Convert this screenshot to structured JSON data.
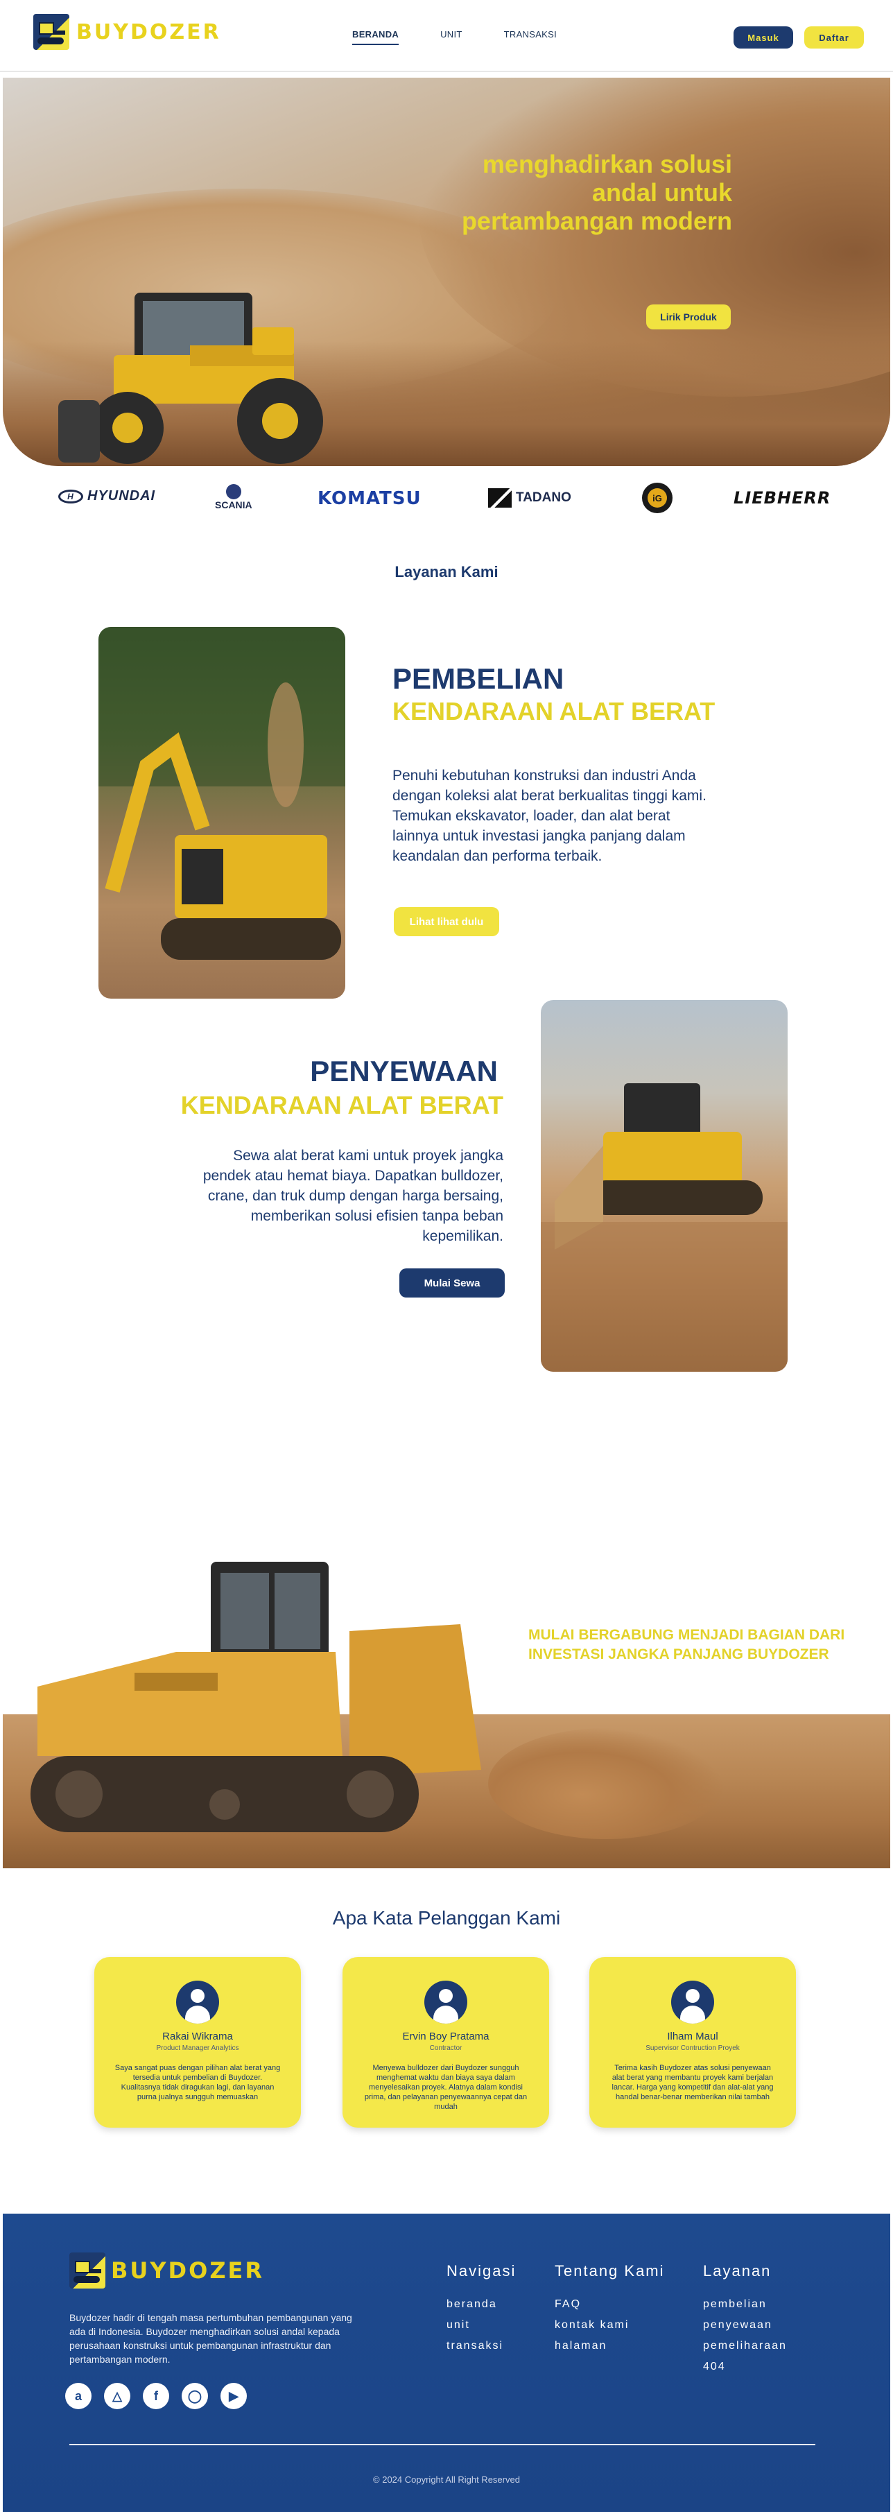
{
  "brand": {
    "name": "BUYDOZER"
  },
  "nav": {
    "links": [
      "BERANDA",
      "UNIT",
      "TRANSAKSI"
    ],
    "login_label": "Masuk",
    "register_label": "Daftar"
  },
  "hero": {
    "title": "menghadirkan solusi andal untuk pertambangan modern",
    "cta_label": "Lirik Produk"
  },
  "partners": {
    "logos": [
      "HYUNDAI",
      "SCANIA",
      "KOMATSU",
      "TADANO",
      "iG",
      "LIEBHERR"
    ]
  },
  "services": {
    "title": "Layanan Kami",
    "purchase": {
      "heading": "PEMBELIAN",
      "subheading": "KENDARAAN ALAT BERAT",
      "description": "Penuhi kebutuhan konstruksi dan industri Anda dengan koleksi alat berat berkualitas tinggi kami. Temukan ekskavator, loader, dan alat berat lainnya untuk investasi jangka panjang dalam keandalan dan performa terbaik.",
      "cta_label": "Lihat lihat dulu"
    },
    "rental": {
      "heading": "PENYEWAAN",
      "subheading": "KENDARAAN ALAT BERAT",
      "description": "Sewa alat berat kami untuk proyek jangka pendek atau hemat biaya. Dapatkan bulldozer, crane, dan truk dump dengan harga bersaing, memberikan solusi efisien tanpa beban kepemilikan.",
      "cta_label": "Mulai Sewa"
    }
  },
  "join": {
    "text": "MULAI BERGABUNG MENJADI BAGIAN DARI INVESTASI JANGKA PANJANG BUYDOZER"
  },
  "testimonials": {
    "title": "Apa Kata Pelanggan Kami",
    "items": [
      {
        "name": "Rakai Wikrama",
        "role": "Product Manager Analytics",
        "quote": "Saya sangat puas dengan pilihan alat berat yang tersedia untuk pembelian di Buydozer. Kualitasnya tidak diragukan lagi, dan layanan purna jualnya sungguh memuaskan"
      },
      {
        "name": "Ervin Boy Pratama",
        "role": "Contractor",
        "quote": "Menyewa bulldozer dari Buydozer sungguh menghemat waktu dan biaya saya dalam menyelesaikan proyek. Alatnya dalam kondisi prima, dan pelayanan penyewaannya cepat dan mudah"
      },
      {
        "name": "Ilham Maul",
        "role": "Supervisor Contruction Proyek",
        "quote": "Terima kasih Buydozer atas solusi penyewaan alat berat yang membantu proyek kami berjalan lancar. Harga yang kompetitif dan alat-alat yang handal benar-benar memberikan nilai tambah"
      }
    ]
  },
  "footer": {
    "description": "Buydozer hadir di tengah masa pertumbuhan pembangunan yang ada di Indonesia. Buydozer menghadirkan solusi andal kepada perusahaan konstruksi untuk pembangunan infrastruktur dan pertambangan modern.",
    "columns": [
      {
        "title": "Navigasi",
        "links": [
          "beranda",
          "unit",
          "transaksi"
        ]
      },
      {
        "title": "Tentang Kami",
        "links": [
          "FAQ",
          "kontak kami",
          "halaman"
        ]
      },
      {
        "title": "Layanan",
        "links": [
          "pembelian",
          "penyewaan",
          "pemeliharaan",
          "404"
        ]
      }
    ],
    "social_icons": [
      "amazon-icon",
      "drive-icon",
      "facebook-icon",
      "instagram-icon",
      "youtube-icon"
    ],
    "copyright": "© 2024 Copyright All Right Reserved"
  },
  "colors": {
    "navy": "#1d3a6e",
    "yellow": "#f1e340",
    "footer_blue": "#1e4a8f"
  }
}
